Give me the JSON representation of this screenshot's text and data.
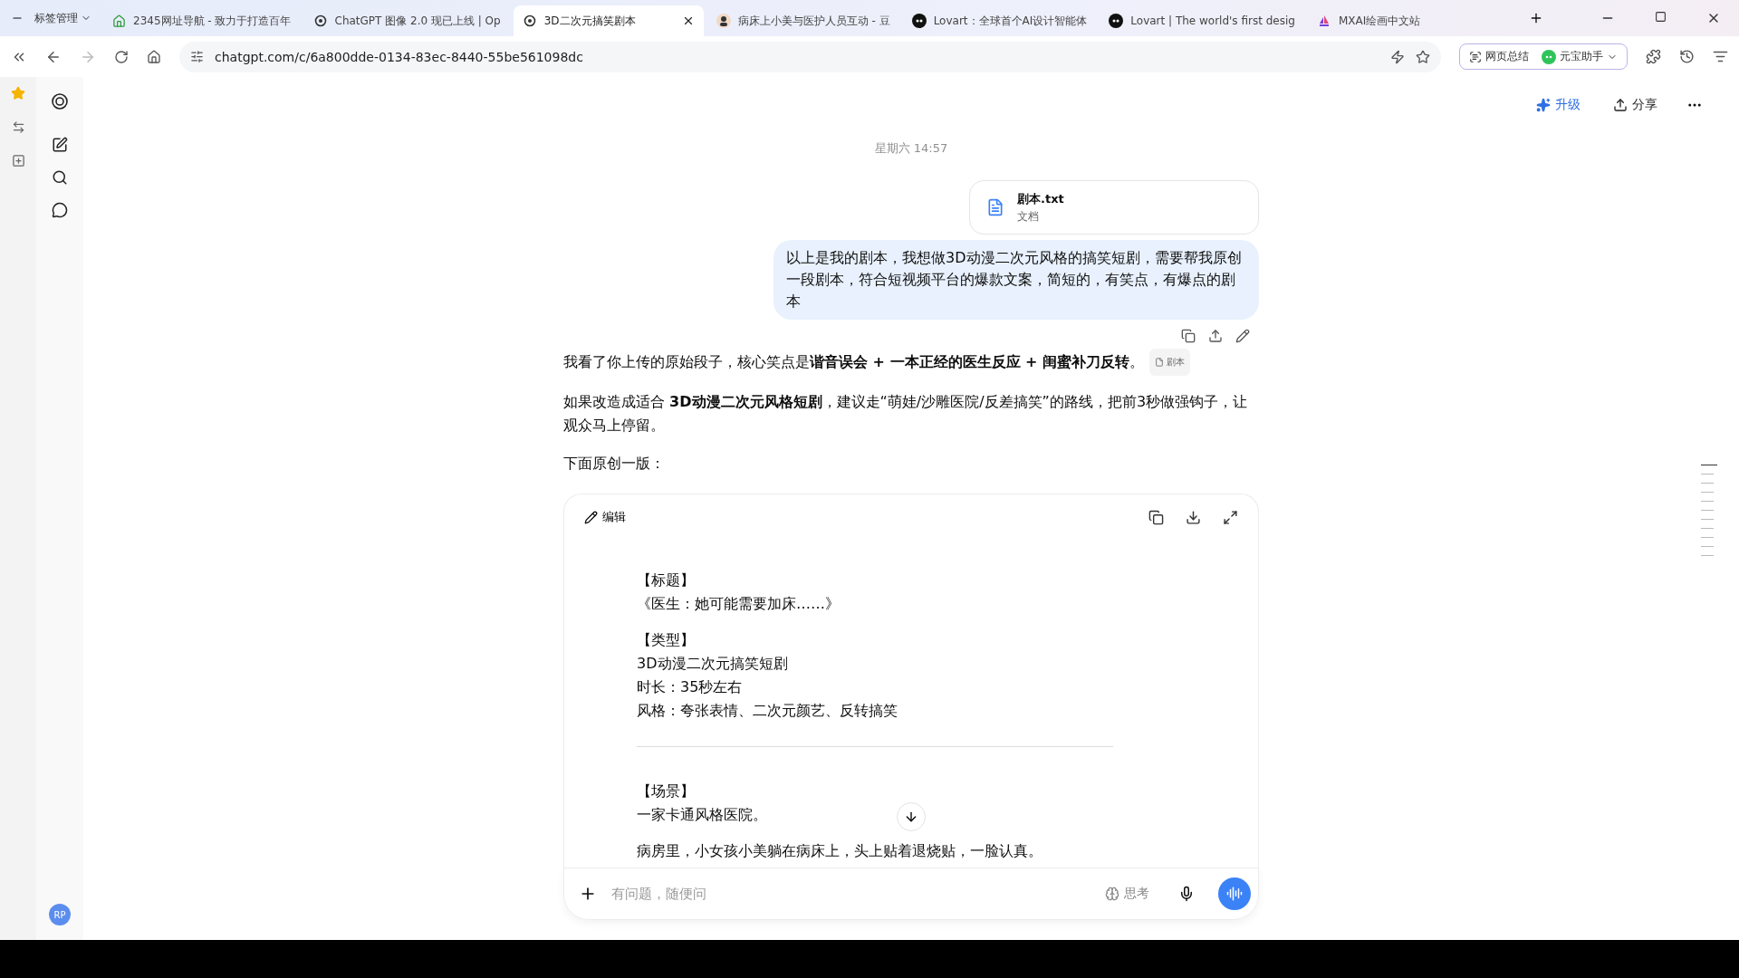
{
  "browser": {
    "tab_group": "标签管理",
    "tabs": [
      {
        "title": "2345网址导航 - 致力于打造百年",
        "selected": false
      },
      {
        "title": "ChatGPT 图像 2.0 现已上线 | Op",
        "selected": false
      },
      {
        "title": "3D二次元搞笑剧本",
        "selected": true
      },
      {
        "title": "病床上小美与医护人员互动 - 豆",
        "selected": false
      },
      {
        "title": "Lovart：全球首个AI设计智能体",
        "selected": false
      },
      {
        "title": "Lovart | The world's first desig",
        "selected": false
      },
      {
        "title": "MXAI绘画中文站",
        "selected": false
      }
    ],
    "url": "chatgpt.com/c/6a800dde-0134-83ec-8440-55be561098dc",
    "summary_button": "网页总结",
    "assistant_button": "元宝助手"
  },
  "header": {
    "upgrade": "升级",
    "share": "分享"
  },
  "chat": {
    "timestamp": "星期六 14:57",
    "attachment": {
      "name": "剧本.txt",
      "type": "文档"
    },
    "user_message": "以上是我的剧本，我想做3D动漫二次元风格的搞笑短剧，需要帮我原创一段剧本，符合短视频平台的爆款文案，简短的，有笑点，有爆点的剧本",
    "reply": [
      {
        "text": "我看了你上传的原始段子，核心笑点是**谐音误会 + 一本正经的医生反应 + 闺蜜补刀反转**。",
        "source": "剧本"
      },
      {
        "text": "如果改造成适合 **3D动漫二次元风格短剧**，建议走“萌娃/沙雕医院/反差搞笑”的路线，把前3秒做强钩子，让观众马上停留。"
      },
      {
        "text": "下面原创一版："
      }
    ],
    "canvas": {
      "edit": "编辑",
      "blocks": [
        {
          "kind": "text",
          "lines": [
            "【标题】",
            "《医生：她可能需要加床……》"
          ]
        },
        {
          "kind": "text",
          "lines": [
            "【类型】",
            "3D动漫二次元搞笑短剧",
            "时长：35秒左右",
            "风格：夸张表情、二次元颜艺、反转搞笑"
          ]
        },
        {
          "kind": "divider"
        },
        {
          "kind": "text",
          "lines": [
            "【场景】",
            "一家卡通风格医院。"
          ]
        },
        {
          "kind": "text",
          "lines": [
            "病房里，小女孩小美躺在病床上，头上贴着退烧贴，一脸认真。"
          ]
        }
      ]
    },
    "composer": {
      "placeholder": "有问题，随便问",
      "think": "思考"
    }
  },
  "avatar": "RP"
}
